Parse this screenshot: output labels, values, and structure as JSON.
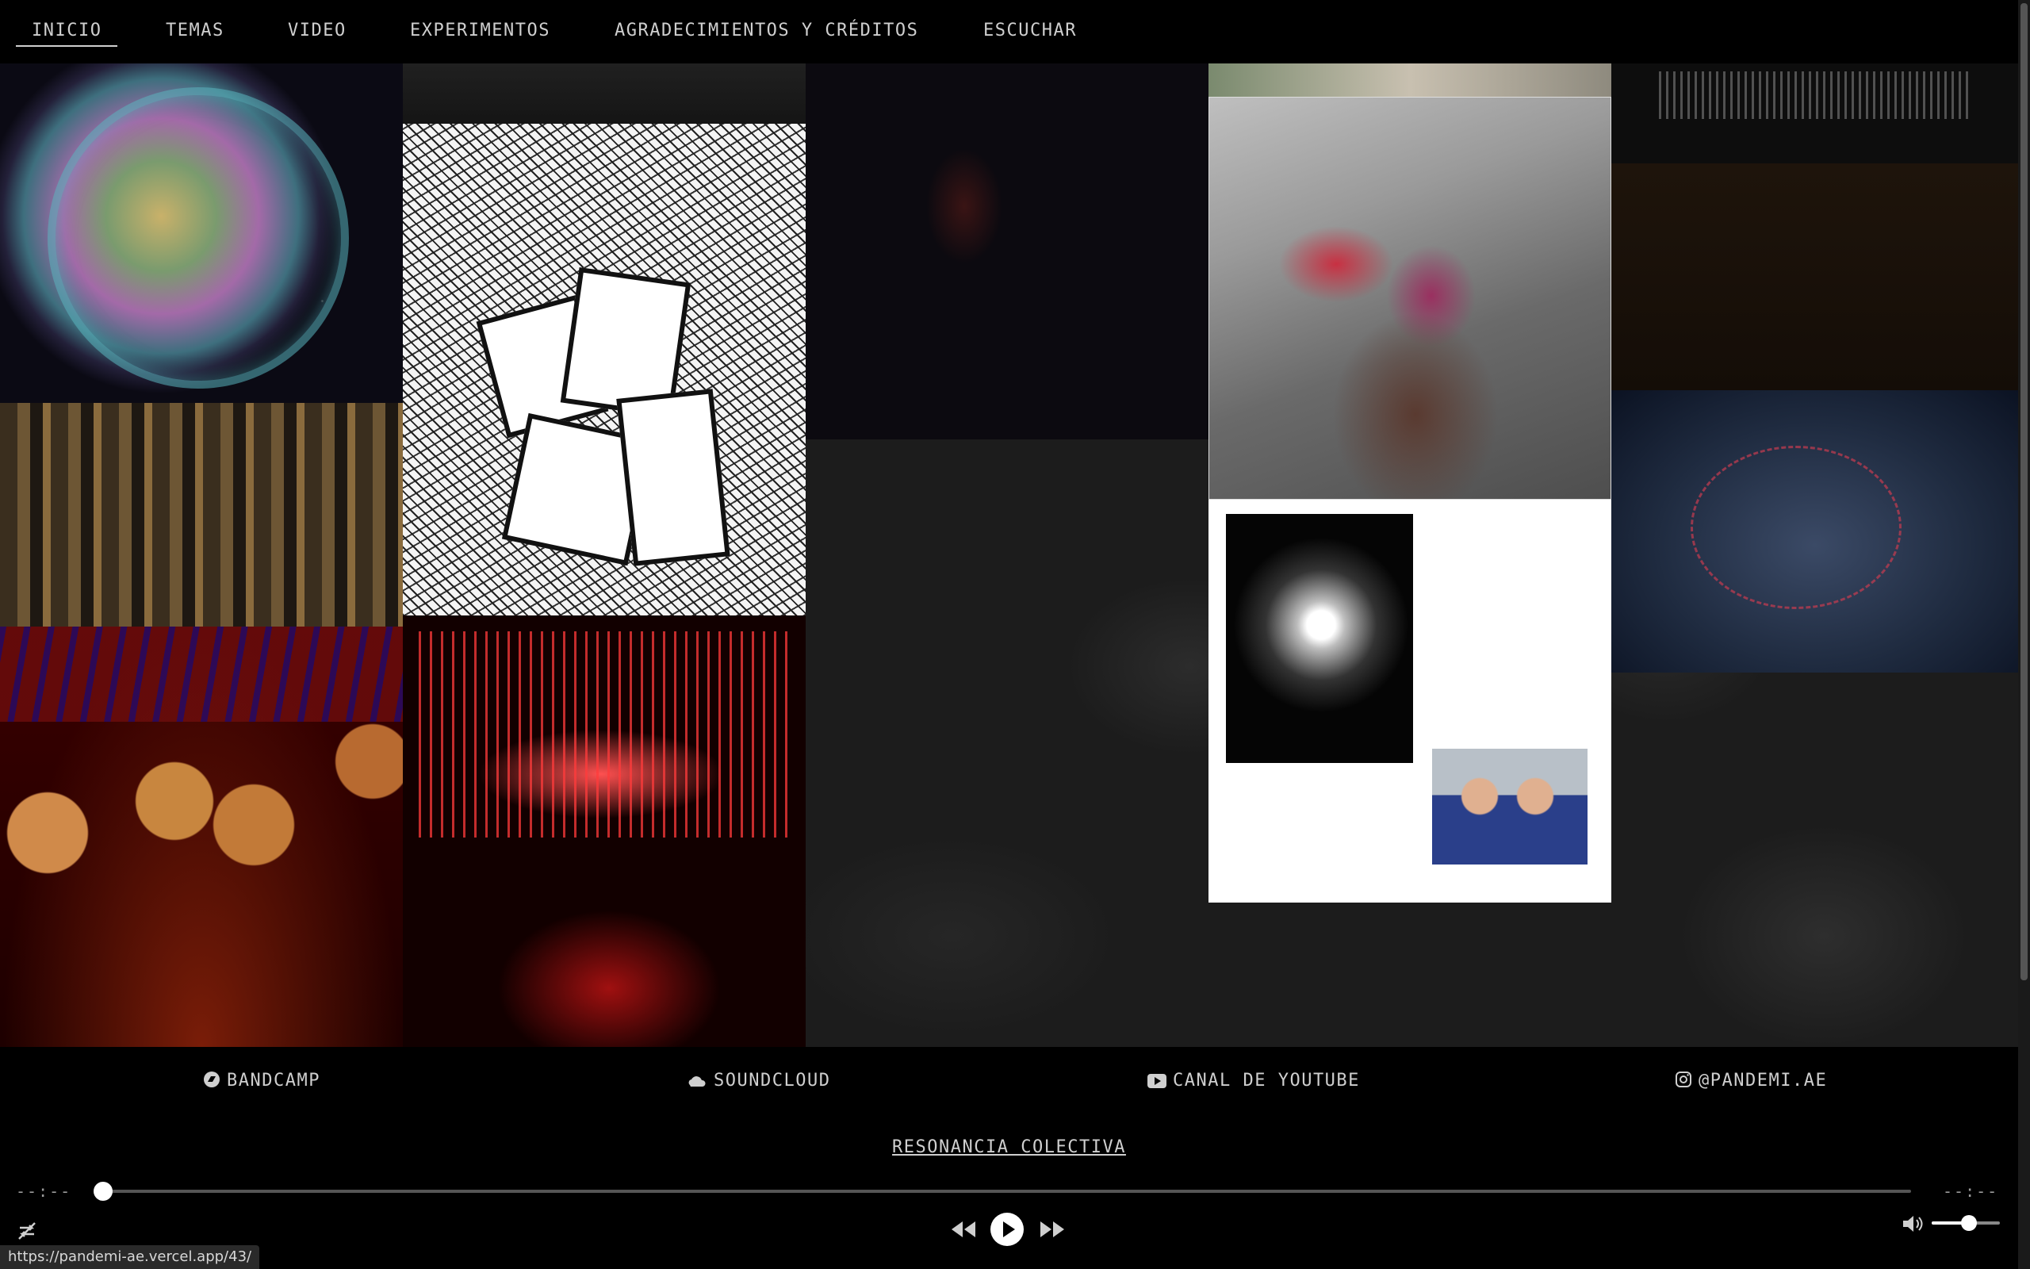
{
  "nav": {
    "items": [
      {
        "label": "INICIO",
        "active": true
      },
      {
        "label": "TEMAS"
      },
      {
        "label": "VIDEO"
      },
      {
        "label": "EXPERIMENTOS"
      },
      {
        "label": "AGRADECIMIENTOS Y CRÉDITOS"
      },
      {
        "label": "ESCUCHAR"
      }
    ]
  },
  "links": [
    {
      "label": "BANDCAMP",
      "icon": "bandcamp-icon"
    },
    {
      "label": "SOUNDCLOUD",
      "icon": "soundcloud-icon"
    },
    {
      "label": "CANAL DE YOUTUBE",
      "icon": "youtube-icon"
    },
    {
      "label": "@PANDEMI.AE",
      "icon": "instagram-icon"
    }
  ],
  "player": {
    "track_title": "RESONANCIA COLECTIVA",
    "elapsed": "--:--",
    "duration": "--:--",
    "progress": 0,
    "volume": 0.55
  },
  "status_url": "https://pandemi-ae.vercel.app/43/",
  "colors": {
    "background": "#000000",
    "text": "#cfcfcf",
    "gallery_bg": "#1c1c1c"
  }
}
